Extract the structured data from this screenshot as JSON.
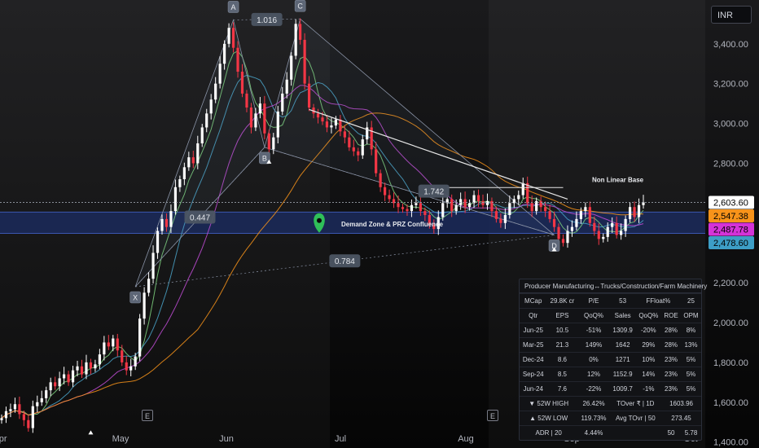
{
  "currency": "INR",
  "colors": {
    "background": "#000000",
    "bull": "#ffffff",
    "bear": "#f23645",
    "demand_zone": "#1b2a5c",
    "price_label": "#ffffff",
    "ma1_label": "#f7931a",
    "ma2_label": "#d433d8",
    "ma3_label": "#3d9ec6"
  },
  "chart_data": {
    "type": "candlestick",
    "title": "",
    "xlabel": "",
    "ylabel": "",
    "x_ticks": [
      "Apr",
      "May",
      "Jun",
      "Jul",
      "Aug",
      "Sep",
      "Oct"
    ],
    "y_ticks": [
      "3,400.00",
      "3,200.00",
      "3,000.00",
      "2,800.00",
      "2,200.00",
      "2,000.00",
      "1,800.00",
      "1,600.00",
      "1,400.00"
    ],
    "ylim": [
      1370,
      3620
    ],
    "price_labels": [
      {
        "text": "2,603.60",
        "value": 2603.6,
        "style": "price_label"
      },
      {
        "text": "2,547.38",
        "value": 2547.38,
        "style": "ma1_label"
      },
      {
        "text": "2,487.78",
        "value": 2487.78,
        "style": "ma2_label"
      },
      {
        "text": "2,478.60",
        "value": 2478.6,
        "style": "ma3_label"
      }
    ],
    "closes": [
      1520,
      1555,
      1565,
      1590,
      1540,
      1510,
      1470,
      1580,
      1600,
      1620,
      1660,
      1700,
      1680,
      1720,
      1740,
      1700,
      1760,
      1780,
      1740,
      1800,
      1770,
      1790,
      1840,
      1900,
      1880,
      1920,
      1860,
      1800,
      1760,
      1780,
      1830,
      2020,
      2150,
      2220,
      2350,
      2460,
      2520,
      2480,
      2560,
      2680,
      2720,
      2780,
      2830,
      2800,
      2900,
      2980,
      3050,
      3120,
      3200,
      3300,
      3400,
      3480,
      3380,
      3260,
      3150,
      3080,
      2980,
      3050,
      3100,
      2950,
      2870,
      2930,
      3060,
      3150,
      3220,
      3340,
      3500,
      3420,
      3200,
      3080,
      3050,
      3030,
      3010,
      2980,
      2990,
      3020,
      2960,
      2930,
      2880,
      2860,
      2840,
      2920,
      2980,
      2870,
      2750,
      2680,
      2640,
      2620,
      2600,
      2580,
      2570,
      2560,
      2590,
      2600,
      2560,
      2540,
      2490,
      2470,
      2530,
      2600,
      2620,
      2560,
      2590,
      2620,
      2580,
      2600,
      2640,
      2610,
      2590,
      2610,
      2560,
      2520,
      2500,
      2540,
      2600,
      2620,
      2640,
      2700,
      2600,
      2560,
      2610,
      2580,
      2560,
      2520,
      2480,
      2420,
      2400,
      2460,
      2480,
      2520,
      2560,
      2580,
      2500,
      2460,
      2420,
      2430,
      2480,
      2500,
      2440,
      2460,
      2520,
      2580,
      2530,
      2590,
      2603.6
    ],
    "pattern_points": [
      {
        "label": "X",
        "value": 2180,
        "index": 30
      },
      {
        "label": "A",
        "value": 3520,
        "index": 52
      },
      {
        "label": "B",
        "value": 2880,
        "index": 59
      },
      {
        "label": "C",
        "value": 3525,
        "index": 67
      },
      {
        "label": "D",
        "value": 2440,
        "index": 124
      }
    ],
    "ratios": [
      "1.016",
      "0.447",
      "1.742",
      "0.784"
    ],
    "annotations": [
      "Demand Zone & PRZ Confluence",
      "Non Linear Base"
    ],
    "demand_zone": [
      2448,
      2555
    ]
  },
  "events": {
    "e1": "E",
    "e2": "E",
    "d_badge": "D",
    "bolt": "⚡"
  },
  "fin_table": {
    "title": "Producer Manufacturing↔Trucks/Construction/Farm Machinery",
    "summary": [
      "MCap",
      "29.8K cr",
      "P/E",
      "53",
      "FFloat%",
      "25"
    ],
    "headers": [
      "Qtr",
      "EPS",
      "QoQ%",
      "Sales",
      "QoQ%",
      "ROE",
      "OPM"
    ],
    "rows": [
      [
        "Jun-25",
        "10.5",
        "-51%",
        "1309.9",
        "-20%",
        "28%",
        "8%"
      ],
      [
        "Mar-25",
        "21.3",
        "149%",
        "1642",
        "29%",
        "28%",
        "13%"
      ],
      [
        "Dec-24",
        "8.6",
        "0%",
        "1271",
        "10%",
        "23%",
        "5%"
      ],
      [
        "Sep-24",
        "8.5",
        "12%",
        "1152.9",
        "14%",
        "23%",
        "5%"
      ],
      [
        "Jun-24",
        "7.6",
        "-22%",
        "1009.7",
        "-1%",
        "23%",
        "5%"
      ]
    ],
    "stats": [
      [
        "▼ 52W HIGH",
        "26.42%",
        "TOver ₹ | 1D",
        "1603.96"
      ],
      [
        "▲ 52W LOW",
        "119.73%",
        "Avg TOvr | 50",
        "273.45"
      ],
      [
        "ADR | 20",
        "4.44%",
        "50",
        "5.78"
      ]
    ]
  }
}
